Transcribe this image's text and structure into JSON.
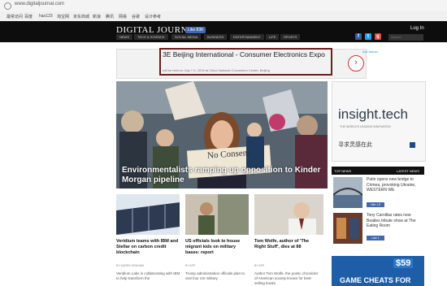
{
  "browser": {
    "url": "www.digitaljournal.com",
    "bookmarks": [
      "最常访问",
      "百度",
      "hao123",
      "淘宝网",
      "京东商城",
      "新浪",
      "腾讯",
      "网易",
      "谷歌",
      "设计参考"
    ]
  },
  "header": {
    "logo": "DIGITAL JOURNAL",
    "like_button": "Like 83K",
    "login": "Log In",
    "nav": [
      "NEWS",
      "TECH & SCIENCE",
      "SOCIAL MEDIA",
      "BUSINESS",
      "ENTERTAINMENT",
      "LIFE",
      "SPORTS"
    ],
    "search_placeholder": "Search"
  },
  "ad_banner": {
    "title": "3E Beijing International - Consumer Electronics Expo",
    "subtitle": "will be held on July 7-9, 2018 at China National Convention Center, Beijing",
    "adchoices": "AdChoices",
    "arrow": "›"
  },
  "hero": {
    "caption": "Environmentalists ramping up opposition to Kinder Morgan pipeline",
    "sign_text": "No Consent"
  },
  "right_ad": {
    "brand": "insight.tech",
    "tagline": "THE WORLD'S LEADING INNOVATION",
    "cn_text": "寻求灵感在此"
  },
  "top_news": {
    "tab_left": "TOP NEWS",
    "tab_right": "LATEST NEWS",
    "items": [
      {
        "text": "Putin opens new bridge to Crimea, provoking Ukraine, WESTERN WE",
        "like": "Like 1.5"
      },
      {
        "text": "Tony Carnillas rates new Beatles tribute show at The Eating Room",
        "like": "Like 1"
      }
    ]
  },
  "games_ad": {
    "price": "$59",
    "title": "GAME CHEATS FOR"
  },
  "articles": [
    {
      "title": "Veridium teams with IBM and Stellar on carbon credit blockchain",
      "byline": "BY KAREN GRAHAM",
      "body": "Veridium Labs is collaborating with IBM to help transform the"
    },
    {
      "title": "US officials look to house migrant kids on military bases: report",
      "byline": "BY AFP",
      "body": "Trump administration officials plan to visit four US military"
    },
    {
      "title": "Tom Wolfe, author of 'The Right Stuff', dies at 88",
      "byline": "BY AFP",
      "body": "Author Tom Wolfe, the poetic chronicler of American society known for best-selling books"
    }
  ]
}
